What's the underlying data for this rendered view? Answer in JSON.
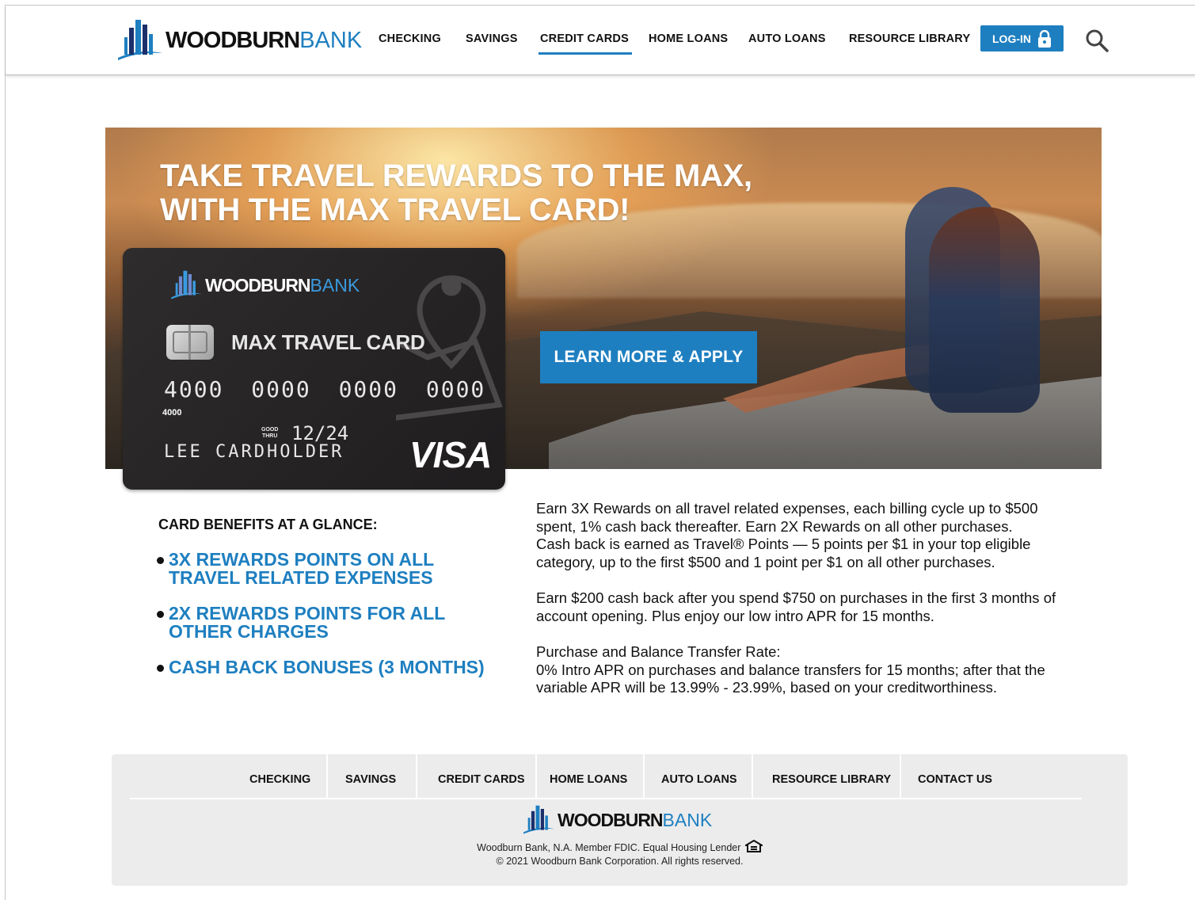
{
  "brand": {
    "name_bold": "WOODBURN",
    "name_light": "BANK",
    "accent": "#1e7fc0"
  },
  "nav": {
    "items": [
      {
        "label": "CHECKING"
      },
      {
        "label": "SAVINGS"
      },
      {
        "label": "CREDIT CARDS",
        "active": true
      },
      {
        "label": "HOME LOANS"
      },
      {
        "label": "AUTO LOANS"
      },
      {
        "label": "RESOURCE LIBRARY"
      }
    ],
    "login_label": "LOG-IN",
    "login_icon": "lock-icon",
    "search_icon": "search-icon"
  },
  "hero": {
    "title_line1": "TAKE TRAVEL REWARDS TO THE MAX,",
    "title_line2": "WITH THE MAX TRAVEL CARD!",
    "cta_label": "LEARN MORE & APPLY"
  },
  "card": {
    "name": "MAX TRAVEL CARD",
    "number": "4000 0000 0000 0000",
    "small_number": "4000",
    "good_thru_line1": "GOOD",
    "good_thru_line2": "THRU",
    "expiry": "12/24",
    "holder": "LEE CARDHOLDER",
    "network": "VISA"
  },
  "benefits": {
    "title": "CARD BENEFITS AT A GLANCE:",
    "items": [
      {
        "line1": "3X REWARDS POINTS ON ALL",
        "line2": "TRAVEL RELATED EXPENSES"
      },
      {
        "line1": "2X REWARDS POINTS FOR ALL",
        "line2": "OTHER CHARGES"
      },
      {
        "line1": "CASH BACK BONUSES (3 MONTHS)",
        "line2": ""
      }
    ]
  },
  "description": {
    "p1": [
      "Earn 3X Rewards on all travel related expenses, each billing cycle up to $500",
      "spent, 1% cash back thereafter. Earn 2X Rewards on all other purchases.",
      "Cash back is earned as Travel® Points — 5 points per $1 in your top eligible",
      "category, up to the first $500 and 1 point per $1 on all other purchases."
    ],
    "p2": [
      "Earn $200 cash back after you spend $750 on purchases in the first 3 months of",
      "account opening. Plus enjoy our low intro APR for 15 months."
    ],
    "p3": [
      "Purchase and Balance Transfer Rate:",
      "0% Intro APR on purchases and balance transfers for 15 months; after that the",
      "variable APR will be 13.99% - 23.99%, based on your creditworthiness."
    ]
  },
  "footer": {
    "nav": [
      "CHECKING",
      "SAVINGS",
      "CREDIT CARDS",
      "HOME LOANS",
      "AUTO LOANS",
      "RESOURCE LIBRARY",
      "CONTACT US"
    ],
    "legal_line1": "Woodburn Bank, N.A. Member FDIC. Equal Housing Lender",
    "legal_icon": "equal-housing-icon",
    "legal_line2": "© 2021 Woodburn Bank Corporation. All rights reserved."
  }
}
